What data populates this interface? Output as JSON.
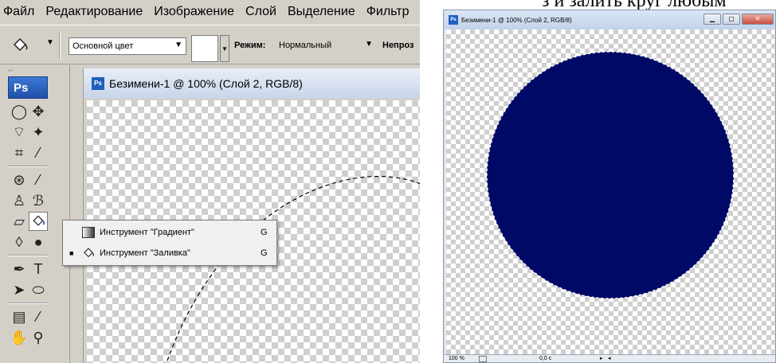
{
  "document_text": "з и залить круг любым",
  "left_window": {
    "menu": [
      "Файл",
      "Редактирование",
      "Изображение",
      "Слой",
      "Выделение",
      "Фильтр"
    ],
    "options_bar": {
      "fill_source": "Основной цвет",
      "mode_label": "Режим:",
      "mode_value": "Нормальный",
      "opacity_label": "Непроз"
    },
    "toolbox": {
      "logo": "Ps"
    },
    "document_title": "Безимени-1 @ 100% (Слой 2, RGB/8)",
    "flyout": [
      {
        "label": "Инструмент \"Градиент\"",
        "shortcut": "G",
        "selected": false,
        "icon": "gradient-icon"
      },
      {
        "label": "Инструмент \"Заливка\"",
        "shortcut": "G",
        "selected": true,
        "icon": "paint-bucket-icon"
      }
    ]
  },
  "right_window": {
    "title": "Безимени-1 @ 100% (Слой 2, RGB/8)",
    "fill_color": "#000a66",
    "status": {
      "zoom": "100 %",
      "timing": "0,0 с"
    }
  },
  "colors": {
    "panel": "#d4d0c8",
    "circle": "#000a66"
  }
}
